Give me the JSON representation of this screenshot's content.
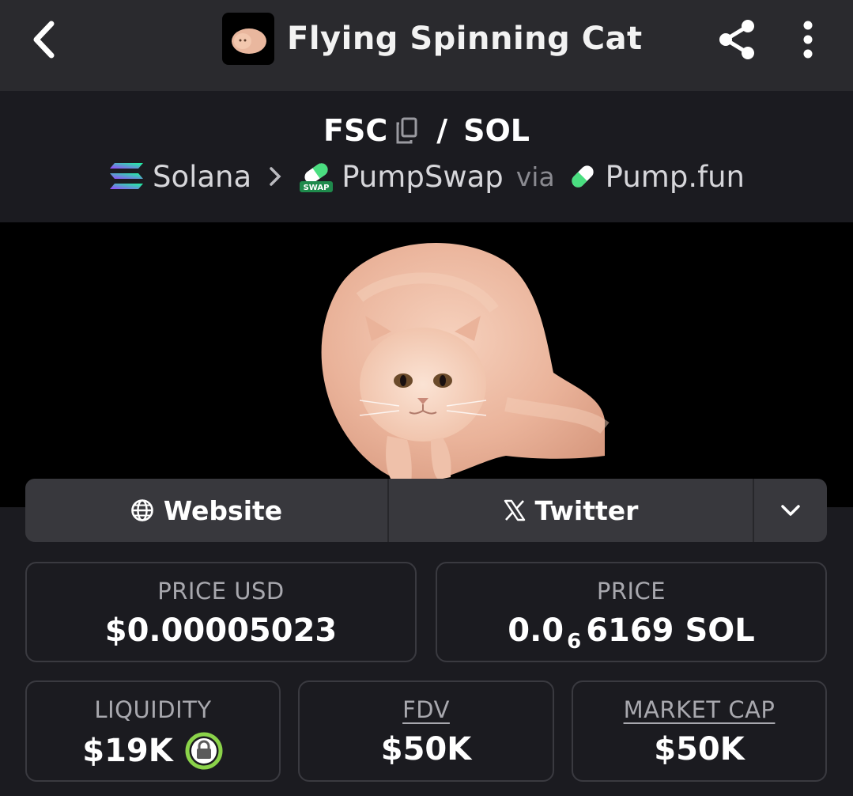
{
  "header": {
    "title": "Flying Spinning Cat",
    "back_icon": "chevron-left-icon",
    "share_icon": "share-icon",
    "more_icon": "more-vertical-icon"
  },
  "pair": {
    "base": "FSC",
    "separator": "/",
    "quote": "SOL",
    "chain": "Solana",
    "dex": "PumpSwap",
    "via_label": "via",
    "launchpad": "Pump.fun",
    "dex_badge": "SWAP"
  },
  "links": {
    "website_label": "Website",
    "twitter_label": "Twitter"
  },
  "stats": {
    "price_usd": {
      "label": "PRICE USD",
      "value": "$0.00005023"
    },
    "price": {
      "label": "PRICE",
      "value_prefix": "0.0",
      "zeros": "6",
      "value_suffix": "6169 SOL"
    },
    "liquidity": {
      "label": "LIQUIDITY",
      "value": "$19K"
    },
    "fdv": {
      "label": "FDV",
      "value": "$50K"
    },
    "market_cap": {
      "label": "MARKET CAP",
      "value": "$50K"
    }
  },
  "colors": {
    "header_bg": "#2a2a2e",
    "page_bg": "#1b1b20",
    "links_bg": "#38383d",
    "card_border": "#3a3a40",
    "lock_green": "#8bd34a",
    "solana_gradient": [
      "#9945ff",
      "#19fb9b"
    ],
    "pump_green": "#4ade80"
  }
}
